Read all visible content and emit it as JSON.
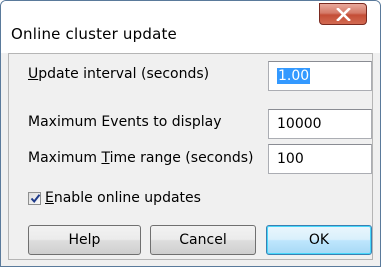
{
  "window": {
    "title": "Online cluster update",
    "close_glyph": "close-icon"
  },
  "fields": {
    "update_interval": {
      "label_accel": "U",
      "label_rest": "pdate interval (seconds)",
      "value": "1.00"
    },
    "max_events": {
      "label": "Maximum Events to display",
      "value": "10000"
    },
    "max_time": {
      "label_pre": "Maximum ",
      "label_accel": "T",
      "label_rest": "ime range (seconds)",
      "value": "100"
    }
  },
  "online_updates": {
    "label_accel": "E",
    "label_rest": "nable online updates",
    "checked": true
  },
  "buttons": {
    "help": "Help",
    "cancel": "Cancel",
    "ok": "OK"
  },
  "colors": {
    "close_button": "#c44e37",
    "selection": "#3399ff",
    "default_button_border": "#3c7fb1"
  }
}
